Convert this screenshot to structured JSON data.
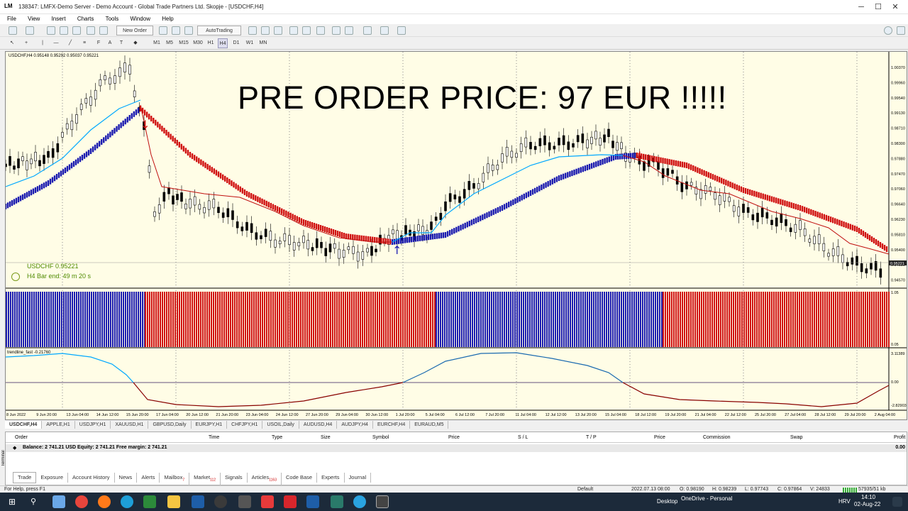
{
  "window": {
    "logo": "LM",
    "title": "138347: LMFX-Demo Server - Demo Account - Global Trade Partners Ltd. Skopje - [USDCHF,H4]",
    "controls": [
      "─",
      "☐",
      "✕"
    ]
  },
  "menu": [
    "File",
    "View",
    "Insert",
    "Charts",
    "Tools",
    "Window",
    "Help"
  ],
  "toolbar": {
    "new_order": "New Order",
    "autotrading": "AutoTrading",
    "timeframes": [
      "M1",
      "M5",
      "M15",
      "M30",
      "H1",
      "H4",
      "D1",
      "W1",
      "MN"
    ]
  },
  "chart": {
    "header": "USDCHF,H4  0.95148 0.95292 0.95037 0.95221",
    "overlay_text": "PRE ORDER PRICE: 97 EUR !!!!!",
    "symbol_label": "USDCHF  0.95221",
    "bar_end": "H4 Bar end: 49 m 20 s",
    "current_price": "0.95221",
    "indicator2_label": "trendline_fast -0.21760",
    "price_ticks": [
      "1.00370",
      "0.99960",
      "0.99540",
      "0.99130",
      "0.98710",
      "0.98300",
      "0.97880",
      "0.97470",
      "0.97060",
      "0.96640",
      "0.96230",
      "0.95810",
      "0.95400",
      "0.94980",
      "0.94570"
    ],
    "hist_ticks": [
      "1.05",
      "0.05"
    ],
    "osc_ticks": [
      "3.11389",
      "0.00",
      "-2.82903"
    ],
    "time_ticks": [
      "8 Jun 2022",
      "9 Jun 20:00",
      "13 Jun 04:00",
      "14 Jun 12:00",
      "15 Jun 20:00",
      "17 Jun 04:00",
      "20 Jun 12:00",
      "21 Jun 20:00",
      "23 Jun 04:00",
      "24 Jun 12:00",
      "27 Jun 20:00",
      "29 Jun 04:00",
      "30 Jun 12:00",
      "1 Jul 20:00",
      "5 Jul 04:00",
      "6 Jul 12:00",
      "7 Jul 20:00",
      "11 Jul 04:00",
      "12 Jul 12:00",
      "13 Jul 20:00",
      "15 Jul 04:00",
      "18 Jul 12:00",
      "19 Jul 20:00",
      "21 Jul 04:00",
      "22 Jul 12:00",
      "25 Jul 20:00",
      "27 Jul 04:00",
      "28 Jul 12:00",
      "29 Jul 20:00",
      "2 Aug 04:00"
    ],
    "colors": {
      "background": "#fffde6",
      "blue": "#1a1ab0",
      "red": "#d01010",
      "cyan": "#00a8ff",
      "dark_red": "#c01010"
    }
  },
  "chart_tabs": [
    "USDCHF,H4",
    "APPLE,H1",
    "USDJPY,H1",
    "XAUUSD,H1",
    "GBPUSD,Daily",
    "EURJPY,H1",
    "CHFJPY,H1",
    "USOIL,Daily",
    "AUDUSD,H4",
    "AUDJPY,H4",
    "EURCHF,H4",
    "EURAUD,M5"
  ],
  "terminal": {
    "side_label": "Terminal",
    "columns": [
      "Order",
      "Time",
      "Type",
      "Size",
      "Symbol",
      "Price",
      "S / L",
      "T / P",
      "Price",
      "Commission",
      "Swap",
      "Profit"
    ],
    "balance_text": "Balance: 2 741.21 USD  Equity: 2 741.21  Free margin: 2 741.21",
    "balance_profit": "0.00",
    "tabs": [
      {
        "label": "Trade",
        "badge": ""
      },
      {
        "label": "Exposure",
        "badge": ""
      },
      {
        "label": "Account History",
        "badge": ""
      },
      {
        "label": "News",
        "badge": ""
      },
      {
        "label": "Alerts",
        "badge": ""
      },
      {
        "label": "Mailbox",
        "badge": "7"
      },
      {
        "label": "Market",
        "badge": "112"
      },
      {
        "label": "Signals",
        "badge": ""
      },
      {
        "label": "Articles",
        "badge": "1163"
      },
      {
        "label": "Code Base",
        "badge": ""
      },
      {
        "label": "Experts",
        "badge": ""
      },
      {
        "label": "Journal",
        "badge": ""
      }
    ]
  },
  "status": {
    "help": "For Help, press F1",
    "profile": "Default",
    "datetime": "2022.07.13 08:00",
    "o": "O: 0.98190",
    "h": "H: 0.98239",
    "l": "L: 0.97743",
    "c": "C: 0.97864",
    "v": "V: 24833",
    "traffic": "57935/51 kb"
  },
  "taskbar": {
    "desktop": "Desktop",
    "onedrive": "OneDrive - Personal",
    "lang": "HRV",
    "time": "14:10",
    "date": "02-Aug-22"
  }
}
